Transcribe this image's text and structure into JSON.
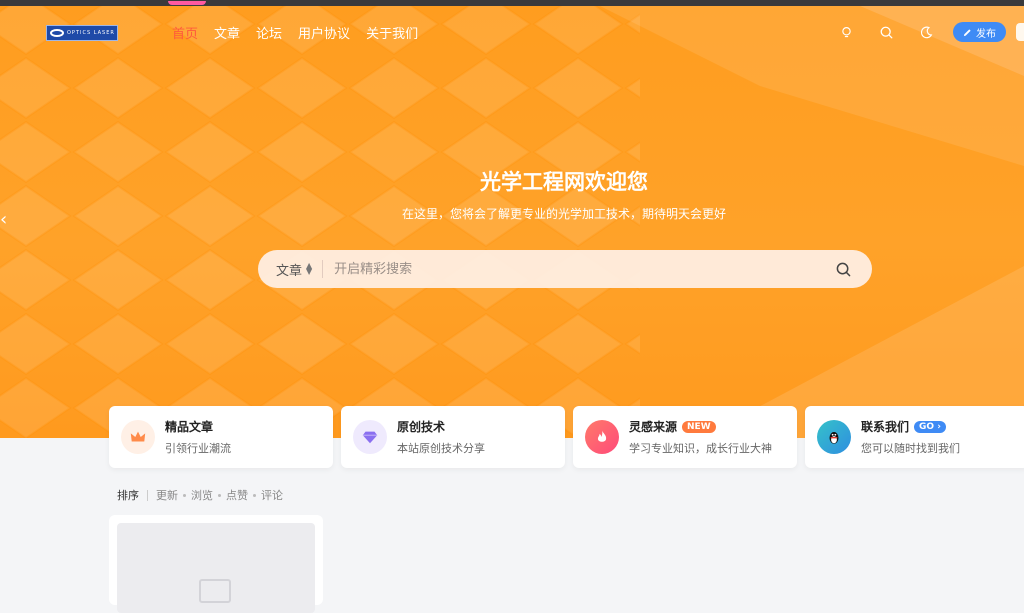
{
  "nav": {
    "logo_text": "OPTICS LASER",
    "menu": [
      "首页",
      "文章",
      "论坛",
      "用户协议",
      "关于我们"
    ],
    "active_index": 0,
    "publish_label": "发布"
  },
  "hero": {
    "title": "光学工程网欢迎您",
    "subtitle": "在这里，您将会了解更专业的光学加工技术，期待明天会更好"
  },
  "search": {
    "type_label": "文章",
    "placeholder": "开启精彩搜索"
  },
  "cards": [
    {
      "title": "精品文章",
      "subtitle": "引领行业潮流",
      "icon": "crown-icon",
      "color": "#ff8b4a",
      "bg": "#fff0e6"
    },
    {
      "title": "原创技术",
      "subtitle": "本站原创技术分享",
      "icon": "diamond-icon",
      "color": "#8a6ff0",
      "bg": "#efeafd"
    },
    {
      "title": "灵感来源",
      "subtitle": "学习专业知识，成长行业大神",
      "icon": "flame-icon",
      "color": "#ffffff",
      "bg": "#ff5a6a",
      "badge": "NEW",
      "badge_color": "#ff7a3d"
    },
    {
      "title": "联系我们",
      "subtitle": "您可以随时找到我们",
      "icon": "qq-penguin-icon",
      "color": "#111111",
      "bg": "#3fb6d9",
      "badge": "GO",
      "badge_color": "#3f8bf5"
    }
  ],
  "sort": {
    "label": "排序",
    "options": [
      "更新",
      "浏览",
      "点赞",
      "评论"
    ]
  },
  "colors": {
    "hero_orange": "#ffa229",
    "active_nav": "#ff5a3c",
    "publish_blue": "#3f8bf5"
  }
}
